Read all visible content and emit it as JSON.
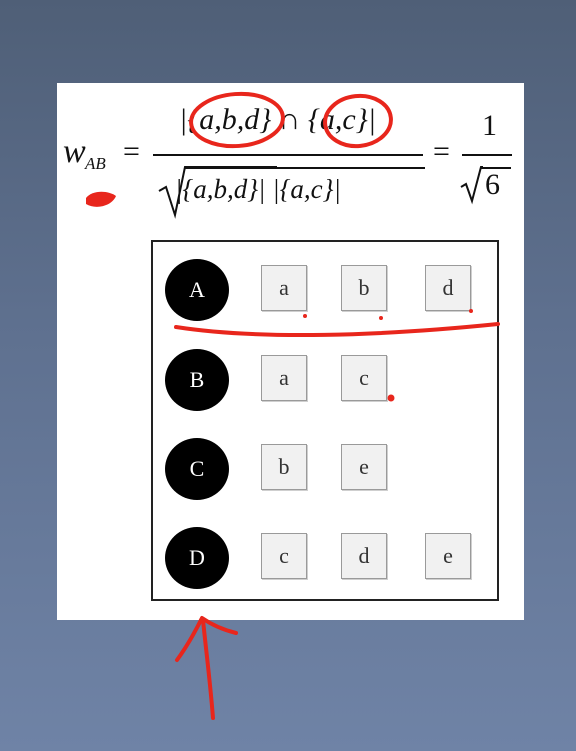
{
  "formula": {
    "lhs_symbol": "w",
    "lhs_subscript": "AB",
    "equals": "=",
    "numerator": "|{a,b,d} ∩ {a,c}|",
    "denominator": "|{a,b,d}| |{a,c}|",
    "rhs_numerator": "1",
    "rhs_denominator": "6"
  },
  "graph": {
    "rows": [
      {
        "node": "A",
        "items": [
          "a",
          "b",
          "d"
        ]
      },
      {
        "node": "B",
        "items": [
          "a",
          "c"
        ]
      },
      {
        "node": "C",
        "items": [
          "b",
          "e"
        ]
      },
      {
        "node": "D",
        "items": [
          "c",
          "d",
          "e"
        ]
      }
    ]
  },
  "annotation_color": "#e8261c",
  "background_color": "#5f7190"
}
